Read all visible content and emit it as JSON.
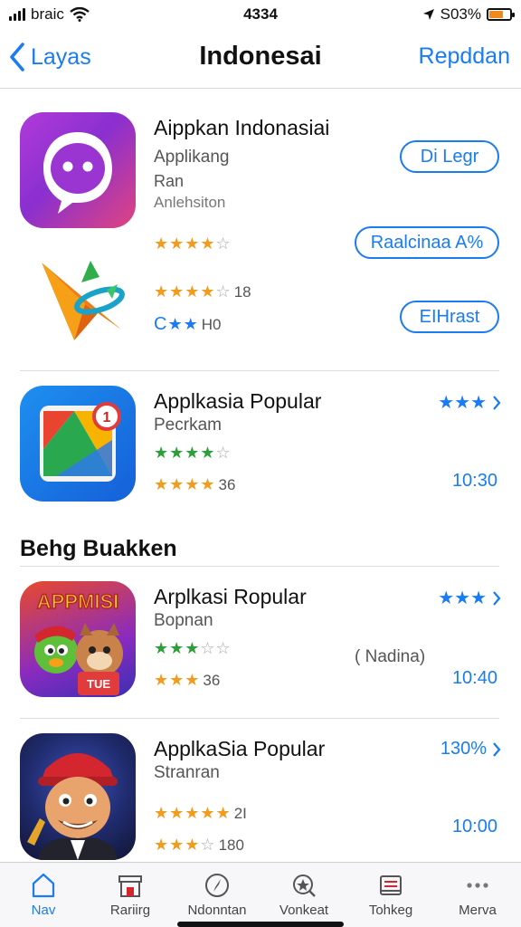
{
  "status_bar": {
    "carrier": "braic",
    "time": "4334",
    "battery": "S03%",
    "battery_level": 0.7
  },
  "nav": {
    "back_label": "Layas",
    "title": "Indonesai",
    "action_label": "Repddan"
  },
  "apps": [
    {
      "title": "Aippkan Indonasiai",
      "subtitle": "Applikang",
      "line3": "Ran",
      "line4": "Anlehsiton",
      "button": "Di Legr",
      "stars_a": {
        "filled": "★★★★",
        "empty": "☆",
        "num": ""
      },
      "badge": "Raalcinaa A%"
    },
    {
      "title": "",
      "stars_a": {
        "filled": "★★★★",
        "empty": "☆",
        "num": "18"
      },
      "stars_b": {
        "prefix": "C",
        "filled": "★★",
        "num": "H0"
      },
      "button": "EIHrast"
    },
    {
      "title": "Applkasia Popular",
      "subtitle": "Pecrkam",
      "stars_a": {
        "filled": "★★★★",
        "empty": "☆",
        "num": ""
      },
      "stars_b": {
        "filled": "★★★★",
        "empty": "",
        "num": "36"
      },
      "right_stars": "★★★",
      "right_value": "10:30",
      "badge_number": "1"
    },
    {
      "title": "Arplkasi Ropular",
      "subtitle": "Bopnan",
      "stars_a": {
        "filled": "★★★",
        "empty": "☆☆",
        "num": ""
      },
      "stars_b": {
        "filled": "★★★",
        "empty": "",
        "num": "36"
      },
      "mid_text": "( Nadina)",
      "right_stars": "★★★",
      "right_value": "10:40",
      "icon_text": "APPMISI",
      "icon_sign": "TUE"
    },
    {
      "title": "ApplkaSia Popular",
      "subtitle": "Stranran",
      "stars_a": {
        "filled": "★★★★★",
        "empty": "",
        "num": "2I"
      },
      "stars_b": {
        "filled": "★★★",
        "empty": "☆",
        "num": "180"
      },
      "right_link": "130%",
      "right_value": "10:00"
    }
  ],
  "section": {
    "title": "Behg Buakken"
  },
  "tabs": [
    {
      "label": "Nav",
      "icon": "home-icon"
    },
    {
      "label": "Rariirg",
      "icon": "store-icon"
    },
    {
      "label": "Ndonntan",
      "icon": "compass-icon"
    },
    {
      "label": "Vonkeat",
      "icon": "star-search-icon"
    },
    {
      "label": "Tohkeg",
      "icon": "tray-icon"
    },
    {
      "label": "Merva",
      "icon": "more-icon"
    }
  ],
  "colors": {
    "accent": "#1a7cf0",
    "star_gold": "#f29b1d",
    "star_green": "#2e9e3b"
  }
}
